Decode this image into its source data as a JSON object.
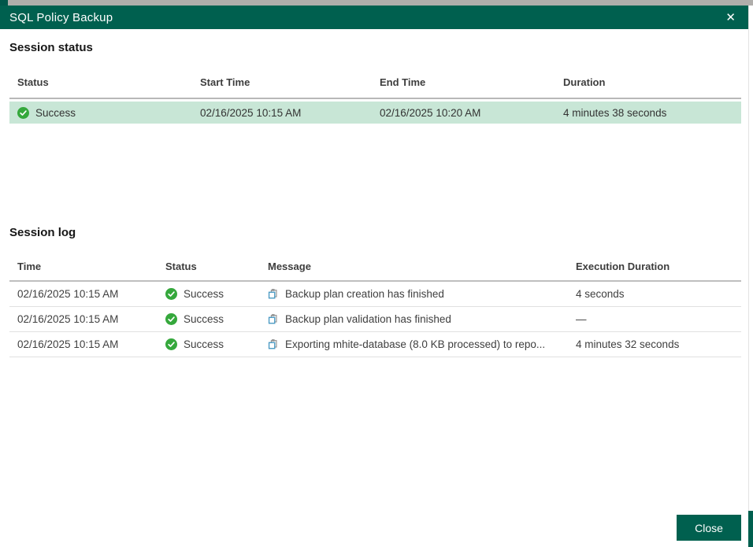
{
  "window": {
    "title": "SQL Policy Backup",
    "close_icon_glyph": "✕"
  },
  "colors": {
    "header_bg": "#00604f",
    "accent_teal": "#00604f",
    "selected_row_bg": "#c8e6d6",
    "success_green": "#35a83c",
    "message_icon_blue": "#4c9bc4"
  },
  "session_status": {
    "heading": "Session status",
    "columns": [
      "Status",
      "Start Time",
      "End Time",
      "Duration"
    ],
    "rows": [
      {
        "status": "Success",
        "start_time": "02/16/2025 10:15 AM",
        "end_time": "02/16/2025 10:20 AM",
        "duration": "4 minutes 38 seconds"
      }
    ]
  },
  "session_log": {
    "heading": "Session log",
    "columns": [
      "Time",
      "Status",
      "Message",
      "Execution Duration"
    ],
    "rows": [
      {
        "time": "02/16/2025 10:15 AM",
        "status": "Success",
        "message": "Backup plan creation has finished",
        "execution_duration": "4 seconds"
      },
      {
        "time": "02/16/2025 10:15 AM",
        "status": "Success",
        "message": "Backup plan validation has finished",
        "execution_duration": "—"
      },
      {
        "time": "02/16/2025 10:15 AM",
        "status": "Success",
        "message": "Exporting mhite-database (8.0 KB processed) to repo...",
        "execution_duration": "4 minutes 32 seconds"
      }
    ]
  },
  "footer": {
    "close_button_label": "Close"
  }
}
